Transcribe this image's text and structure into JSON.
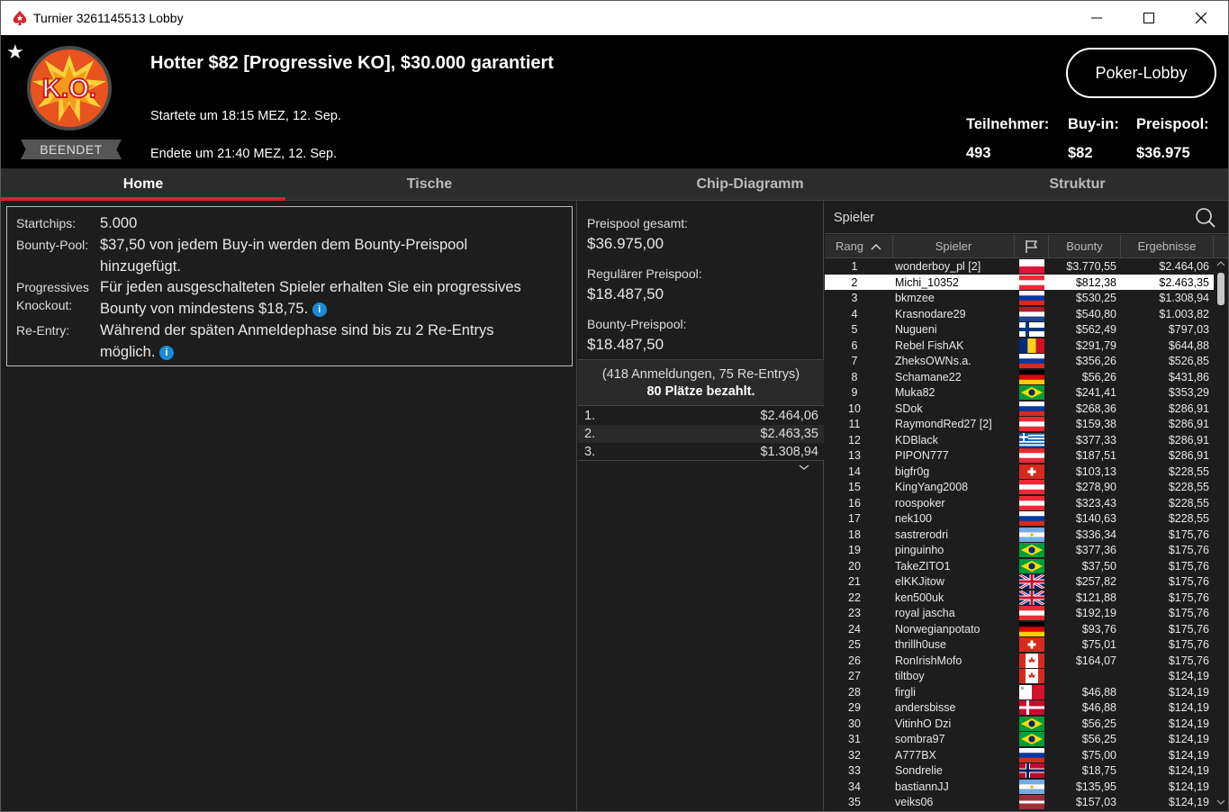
{
  "window": {
    "title": "Turnier 3261145513 Lobby"
  },
  "header": {
    "status_badge": "BEENDET",
    "title": "Hotter $82 [Progressive KO], $30.000 garantiert",
    "started": "Startete um 18:15 MEZ, 12. Sep.",
    "ended": "Endete um 21:40 MEZ, 12. Sep.",
    "lobby_button": "Poker-Lobby",
    "logo_text": "K.O.",
    "stats": [
      {
        "label": "Teilnehmer:",
        "value": "493"
      },
      {
        "label": "Buy-in:",
        "value": "$82"
      },
      {
        "label": "Preispool:",
        "value": "$36.975"
      }
    ]
  },
  "tabs": [
    "Home",
    "Tische",
    "Chip-Diagramm",
    "Struktur"
  ],
  "info": {
    "startchips_label": "Startchips:",
    "startchips_value": "5.000",
    "bounty_label": "Bounty-Pool:",
    "bounty_value": "$37,50 von jedem Buy-in werden dem Bounty-Preispool hinzugefügt.",
    "pko_label_1": "Progressives",
    "pko_label_2": "Knockout:",
    "pko_value": "Für jeden ausgeschalteten Spieler erhalten Sie ein progressives Bounty von mindestens $18,75.",
    "reentry_label": "Re-Entry:",
    "reentry_value": "Während der späten Anmeldephase sind bis zu 2 Re-Entrys möglich.",
    "info_glyph": "i"
  },
  "prize": {
    "total_label": "Preispool gesamt:",
    "total_value": "$36.975,00",
    "regular_label": "Regulärer Preispool:",
    "regular_value": "$18.487,50",
    "bounty_label": "Bounty-Preispool:",
    "bounty_value": "$18.487,50",
    "registrations": "(418 Anmeldungen, 75 Re-Entrys)",
    "paid": "80 Plätze bezahlt.",
    "payouts": [
      {
        "pos": "1.",
        "amount": "$2.464,06"
      },
      {
        "pos": "2.",
        "amount": "$2.463,35"
      },
      {
        "pos": "3.",
        "amount": "$1.308,94"
      }
    ]
  },
  "players": {
    "title": "Spieler",
    "columns": {
      "rank": "Rang",
      "name": "Spieler",
      "bounty": "Bounty",
      "result": "Ergebnisse"
    },
    "rows": [
      {
        "rank": "1",
        "name": "wonderboy_pl [2]",
        "flag": "pl",
        "bounty": "$3.770,55",
        "result": "$2.464,06"
      },
      {
        "rank": "2",
        "name": "Michi_10352",
        "flag": "at",
        "bounty": "$812,38",
        "result": "$2.463,35"
      },
      {
        "rank": "3",
        "name": "bkmzee",
        "flag": "ru",
        "bounty": "$530,25",
        "result": "$1.308,94"
      },
      {
        "rank": "4",
        "name": "Krasnodare29",
        "flag": "nl",
        "bounty": "$540,80",
        "result": "$1.003,82"
      },
      {
        "rank": "5",
        "name": "Nugueni",
        "flag": "fi",
        "bounty": "$562,49",
        "result": "$797,03"
      },
      {
        "rank": "6",
        "name": "Rebel FishAK",
        "flag": "ro",
        "bounty": "$291,79",
        "result": "$644,88"
      },
      {
        "rank": "7",
        "name": "ZheksOWNs.a.",
        "flag": "ru",
        "bounty": "$356,26",
        "result": "$526,85"
      },
      {
        "rank": "8",
        "name": "Schamane22",
        "flag": "de",
        "bounty": "$56,26",
        "result": "$431,86"
      },
      {
        "rank": "9",
        "name": "Muka82",
        "flag": "br",
        "bounty": "$241,41",
        "result": "$353,29"
      },
      {
        "rank": "10",
        "name": "SDok",
        "flag": "ru",
        "bounty": "$268,36",
        "result": "$286,91"
      },
      {
        "rank": "11",
        "name": "RaymondRed27 [2]",
        "flag": "at",
        "bounty": "$159,38",
        "result": "$286,91"
      },
      {
        "rank": "12",
        "name": "KDBlack",
        "flag": "gr",
        "bounty": "$377,33",
        "result": "$286,91"
      },
      {
        "rank": "13",
        "name": "PIPON777",
        "flag": "at",
        "bounty": "$187,51",
        "result": "$286,91"
      },
      {
        "rank": "14",
        "name": "bigfr0g",
        "flag": "ch",
        "bounty": "$103,13",
        "result": "$228,55"
      },
      {
        "rank": "15",
        "name": "KingYang2008",
        "flag": "at",
        "bounty": "$278,90",
        "result": "$228,55"
      },
      {
        "rank": "16",
        "name": "roospoker",
        "flag": "at",
        "bounty": "$323,43",
        "result": "$228,55"
      },
      {
        "rank": "17",
        "name": "nek100",
        "flag": "ru",
        "bounty": "$140,63",
        "result": "$228,55"
      },
      {
        "rank": "18",
        "name": "sastrerodri",
        "flag": "ar",
        "bounty": "$336,34",
        "result": "$175,76"
      },
      {
        "rank": "19",
        "name": "pinguinho",
        "flag": "br",
        "bounty": "$377,36",
        "result": "$175,76"
      },
      {
        "rank": "20",
        "name": "TakeZITO1",
        "flag": "br",
        "bounty": "$37,50",
        "result": "$175,76"
      },
      {
        "rank": "21",
        "name": "elKKJitow",
        "flag": "gb",
        "bounty": "$257,82",
        "result": "$175,76"
      },
      {
        "rank": "22",
        "name": "ken500uk",
        "flag": "gb",
        "bounty": "$121,88",
        "result": "$175,76"
      },
      {
        "rank": "23",
        "name": "royal jascha",
        "flag": "at",
        "bounty": "$192,19",
        "result": "$175,76"
      },
      {
        "rank": "24",
        "name": "Norwegianpotato",
        "flag": "de",
        "bounty": "$93,76",
        "result": "$175,76"
      },
      {
        "rank": "25",
        "name": "thrillh0use",
        "flag": "ch",
        "bounty": "$75,01",
        "result": "$175,76"
      },
      {
        "rank": "26",
        "name": "RonIrishMofo",
        "flag": "ca",
        "bounty": "$164,07",
        "result": "$175,76"
      },
      {
        "rank": "27",
        "name": "tiltboy",
        "flag": "ca",
        "bounty": "",
        "result": "$124,19"
      },
      {
        "rank": "28",
        "name": "firgli",
        "flag": "mt",
        "bounty": "$46,88",
        "result": "$124,19"
      },
      {
        "rank": "29",
        "name": "andersbisse",
        "flag": "dk",
        "bounty": "$46,88",
        "result": "$124,19"
      },
      {
        "rank": "30",
        "name": "VitinhO Dzi",
        "flag": "br",
        "bounty": "$56,25",
        "result": "$124,19"
      },
      {
        "rank": "31",
        "name": "sombra97",
        "flag": "br",
        "bounty": "$56,25",
        "result": "$124,19"
      },
      {
        "rank": "32",
        "name": "A777BX",
        "flag": "ru",
        "bounty": "$75,00",
        "result": "$124,19"
      },
      {
        "rank": "33",
        "name": "Sondrelie",
        "flag": "no",
        "bounty": "$18,75",
        "result": "$124,19"
      },
      {
        "rank": "34",
        "name": "bastiannJJ",
        "flag": "ar",
        "bounty": "$135,95",
        "result": "$124,19"
      },
      {
        "rank": "35",
        "name": "veiks06",
        "flag": "lv",
        "bounty": "$157,03",
        "result": "$124,19"
      }
    ],
    "selected_rank": "2"
  },
  "colors": {
    "accent": "#d2232a",
    "info": "#1a8bd6"
  }
}
